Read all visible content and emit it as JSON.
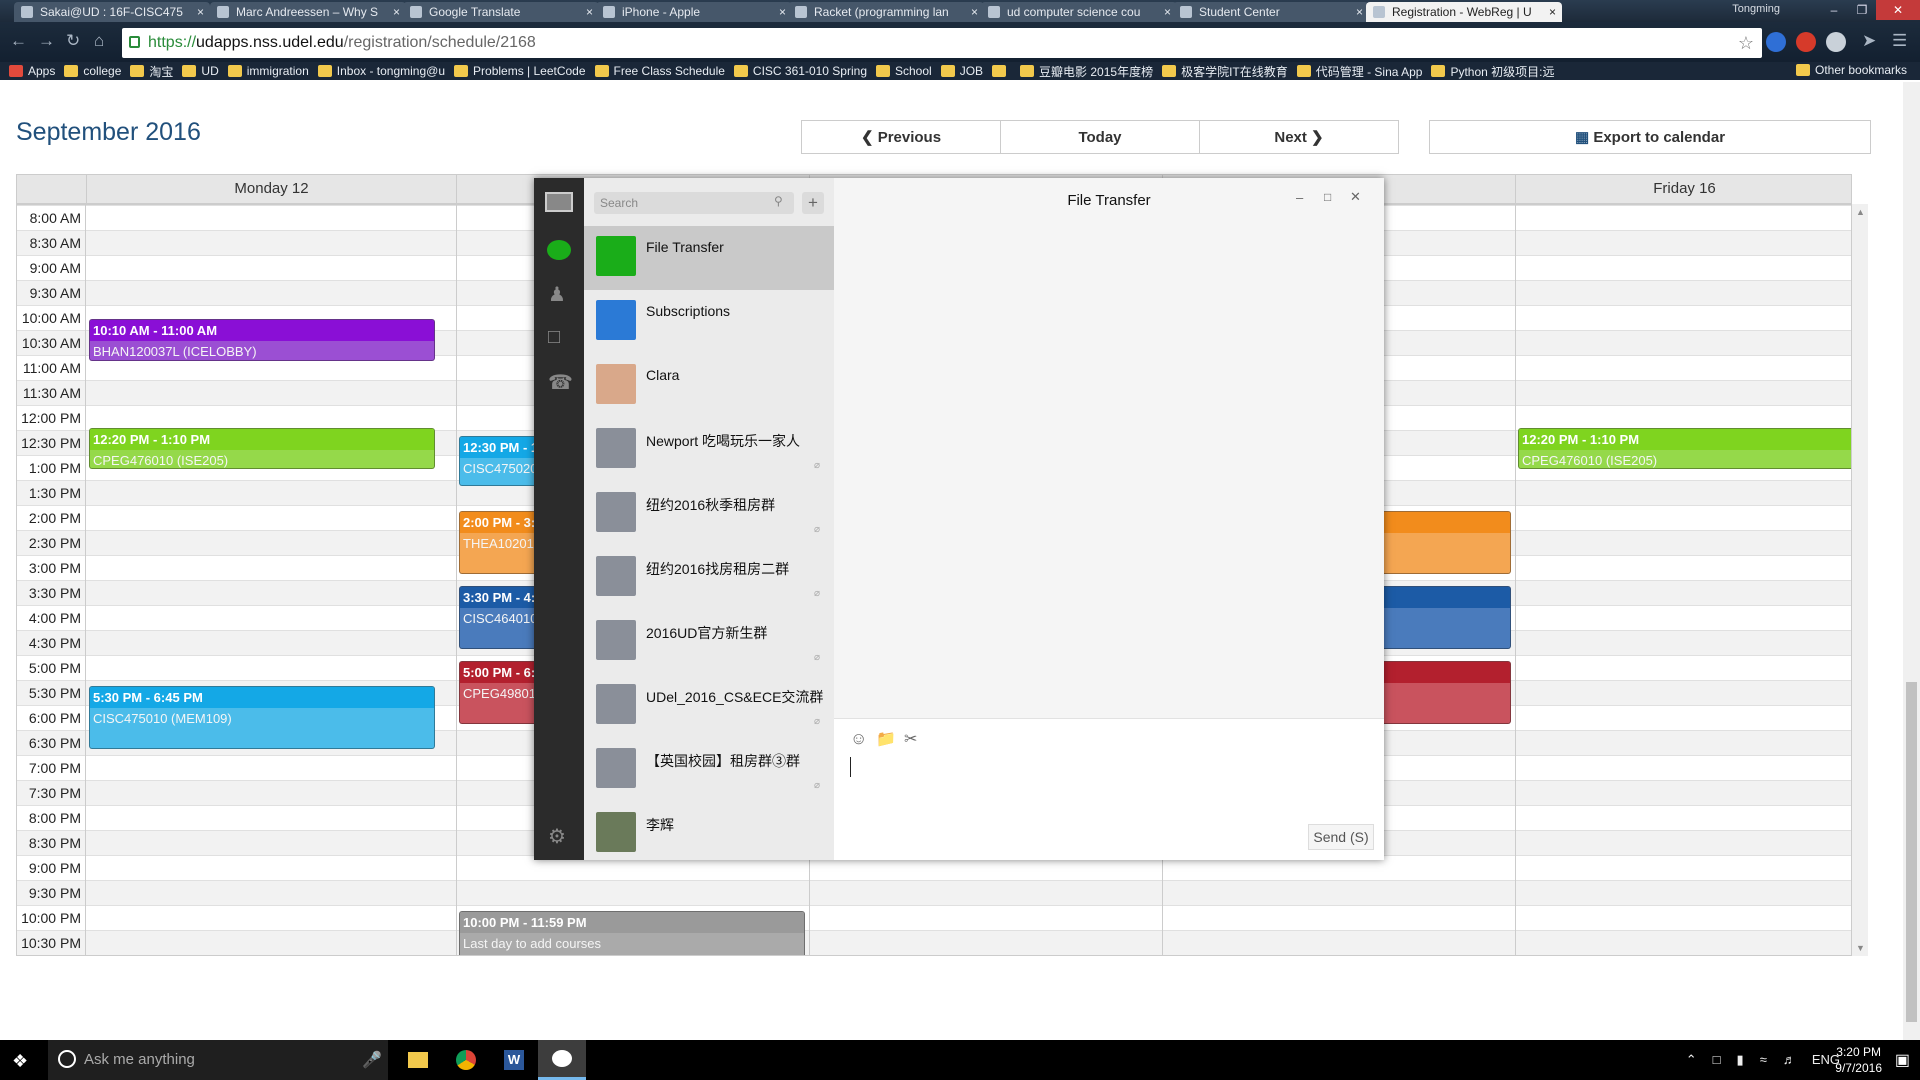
{
  "browser": {
    "tabs": [
      {
        "title": "Sakai@UD : 16F-CISC475",
        "active": false
      },
      {
        "title": "Marc Andreessen – Why S",
        "active": false
      },
      {
        "title": "Google Translate",
        "active": false
      },
      {
        "title": "iPhone - Apple",
        "active": false
      },
      {
        "title": "Racket (programming lan",
        "active": false
      },
      {
        "title": "ud computer science cou",
        "active": false
      },
      {
        "title": "Student Center",
        "active": false
      },
      {
        "title": "Registration - WebReg | U",
        "active": true
      }
    ],
    "profile": "Tongming",
    "url_scheme": "https://",
    "url_host": "udapps.nss.udel.edu",
    "url_path": "/registration/schedule/2168",
    "bookmarks": [
      "Apps",
      "college",
      "淘宝",
      "UD",
      "immigration",
      "Inbox - tongming@u",
      "Problems | LeetCode",
      "Free Class Schedule",
      "CISC 361-010 Spring",
      "School",
      "JOB",
      "",
      "豆瓣电影 2015年度榜",
      "极客学院IT在线教育",
      "代码管理 - Sina App",
      "Python 初级项目:远"
    ],
    "other_bookmarks": "Other bookmarks"
  },
  "calendar": {
    "title": "September 2016",
    "buttons": {
      "previous": "Previous",
      "today": "Today",
      "next": "Next",
      "export": "Export to calendar"
    },
    "days": [
      "Monday 12",
      "",
      "",
      "",
      "Friday 16"
    ],
    "times": [
      "8:00 AM",
      "8:30 AM",
      "9:00 AM",
      "9:30 AM",
      "10:00 AM",
      "10:30 AM",
      "11:00 AM",
      "11:30 AM",
      "12:00 PM",
      "12:30 PM",
      "1:00 PM",
      "1:30 PM",
      "2:00 PM",
      "2:30 PM",
      "3:00 PM",
      "3:30 PM",
      "4:00 PM",
      "4:30 PM",
      "5:00 PM",
      "5:30 PM",
      "6:00 PM",
      "6:30 PM",
      "7:00 PM",
      "7:30 PM",
      "8:00 PM",
      "8:30 PM",
      "9:00 PM",
      "9:30 PM",
      "10:00 PM",
      "10:30 PM"
    ],
    "events": [
      {
        "day": 0,
        "start": 10.1667,
        "end": 11.0,
        "time": "10:10 AM - 11:00 AM",
        "title": "BHAN120037L (ICELOBBY)",
        "color": "#8a0fd6",
        "body": "#9b4fd3"
      },
      {
        "day": 0,
        "start": 12.3333,
        "end": 13.1667,
        "time": "12:20 PM - 1:10 PM",
        "title": "CPEG476010 (ISE205)",
        "color": "#7fd41f",
        "body": "#95d94a"
      },
      {
        "day": 0,
        "start": 17.5,
        "end": 18.75,
        "time": "5:30 PM - 6:45 PM",
        "title": "CISC475010 (MEM109)",
        "color": "#14a8e6",
        "body": "#4bbcea"
      },
      {
        "day": 1,
        "start": 12.5,
        "end": 13.5,
        "time": "12:30 PM - 1:4",
        "title": "CISC475020L",
        "color": "#14a8e6",
        "body": "#4bbcea"
      },
      {
        "day": 1,
        "start": 14.0,
        "end": 15.25,
        "time": "2:00 PM - 3:15",
        "title": "THEA102016 (",
        "color": "#f28c1c",
        "body": "#f4a652"
      },
      {
        "day": 1,
        "start": 15.5,
        "end": 16.75,
        "time": "3:30 PM - 4:45",
        "title": "CISC464010 (",
        "color": "#1c5ba6",
        "body": "#4a7bbc"
      },
      {
        "day": 1,
        "start": 17.0,
        "end": 18.25,
        "time": "5:00 PM - 6:15",
        "title": "CPEG498010",
        "color": "#b3202e",
        "body": "#c9535e"
      },
      {
        "day": 1,
        "start": 22.0,
        "end": 23.0,
        "time": "10:00 PM - 11:59 PM",
        "title": "Last day to add courses",
        "color": "#9a9a9a",
        "body": "#aaaaaa"
      },
      {
        "day": 3,
        "start": 14.0,
        "end": 15.25,
        "time": "",
        "title": "",
        "color": "#f28c1c",
        "body": "#f4a652"
      },
      {
        "day": 3,
        "start": 15.5,
        "end": 16.75,
        "time": "",
        "title": "",
        "color": "#1c5ba6",
        "body": "#4a7bbc"
      },
      {
        "day": 3,
        "start": 17.0,
        "end": 18.25,
        "time": "",
        "title": "",
        "color": "#b3202e",
        "body": "#c9535e"
      },
      {
        "day": 4,
        "start": 12.3333,
        "end": 13.1667,
        "time": "12:20 PM - 1:10 PM",
        "title": "CPEG476010 (ISE205)",
        "color": "#7fd41f",
        "body": "#95d94a"
      }
    ]
  },
  "wechat": {
    "search_placeholder": "Search",
    "window_title": "File Transfer",
    "chats": [
      {
        "name": "File Transfer",
        "avatar": "#1aad19",
        "selected": true,
        "muted": false
      },
      {
        "name": "Subscriptions",
        "avatar": "#2b7ad6",
        "selected": false,
        "muted": false
      },
      {
        "name": "Clara",
        "avatar": "#d9a88a",
        "selected": false,
        "muted": false
      },
      {
        "name": "Newport 吃喝玩乐一家人",
        "avatar": "#8a8f99",
        "selected": false,
        "muted": true
      },
      {
        "name": "纽约2016秋季租房群",
        "avatar": "#8a8f99",
        "selected": false,
        "muted": true
      },
      {
        "name": "纽约2016找房租房二群",
        "avatar": "#8a8f99",
        "selected": false,
        "muted": true
      },
      {
        "name": "2016UD官方新生群",
        "avatar": "#8a8f99",
        "selected": false,
        "muted": true
      },
      {
        "name": "UDel_2016_CS&ECE交流群",
        "avatar": "#8a8f99",
        "selected": false,
        "muted": true
      },
      {
        "name": "【英国校园】租房群③群",
        "avatar": "#8a8f99",
        "selected": false,
        "muted": true
      },
      {
        "name": "李辉",
        "avatar": "#6a7a5a",
        "selected": false,
        "muted": false
      }
    ],
    "send_label": "Send (S)"
  },
  "taskbar": {
    "search_placeholder": "Ask me anything",
    "lang": "ENG",
    "time": "3:20 PM",
    "date": "9/7/2016"
  }
}
